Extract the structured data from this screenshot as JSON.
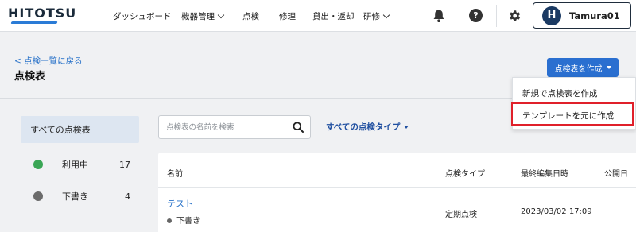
{
  "brand": {
    "logo": "HITOTSU",
    "accent": "#2a7bd6"
  },
  "nav": {
    "dashboard": "ダッシュボード",
    "equipment": "機器管理",
    "inspection": "点検",
    "repair": "修理",
    "lending": "貸出・返却",
    "training": "研修"
  },
  "header": {
    "bell_icon": "bell-icon",
    "help_icon": "help-icon",
    "help_glyph": "?",
    "settings_icon": "gear-icon",
    "user": {
      "initial": "H",
      "name": "Tamura01"
    }
  },
  "page": {
    "back_link": "< 点検一覧に戻る",
    "title": "点検表",
    "create_button": "点検表を作成"
  },
  "dropdown": {
    "items": [
      "新規で点検表を作成",
      "テンプレートを元に作成"
    ],
    "highlight_color": "#e0202a"
  },
  "sidebar": {
    "all_label": "すべての点検表",
    "items": [
      {
        "label": "利用中",
        "count": "17",
        "color": "#3aa655"
      },
      {
        "label": "下書き",
        "count": "4",
        "color": "#6b6b6b"
      }
    ]
  },
  "search": {
    "placeholder": "点検表の名前を検索"
  },
  "filter": {
    "label": "すべての点検タイプ"
  },
  "table": {
    "headers": [
      "名前",
      "点検タイプ",
      "最終編集日時",
      "公開日"
    ],
    "rows": [
      {
        "name": "テスト",
        "status": "下書き",
        "type": "定期点検",
        "edited": "2023/03/02 17:09"
      }
    ]
  }
}
